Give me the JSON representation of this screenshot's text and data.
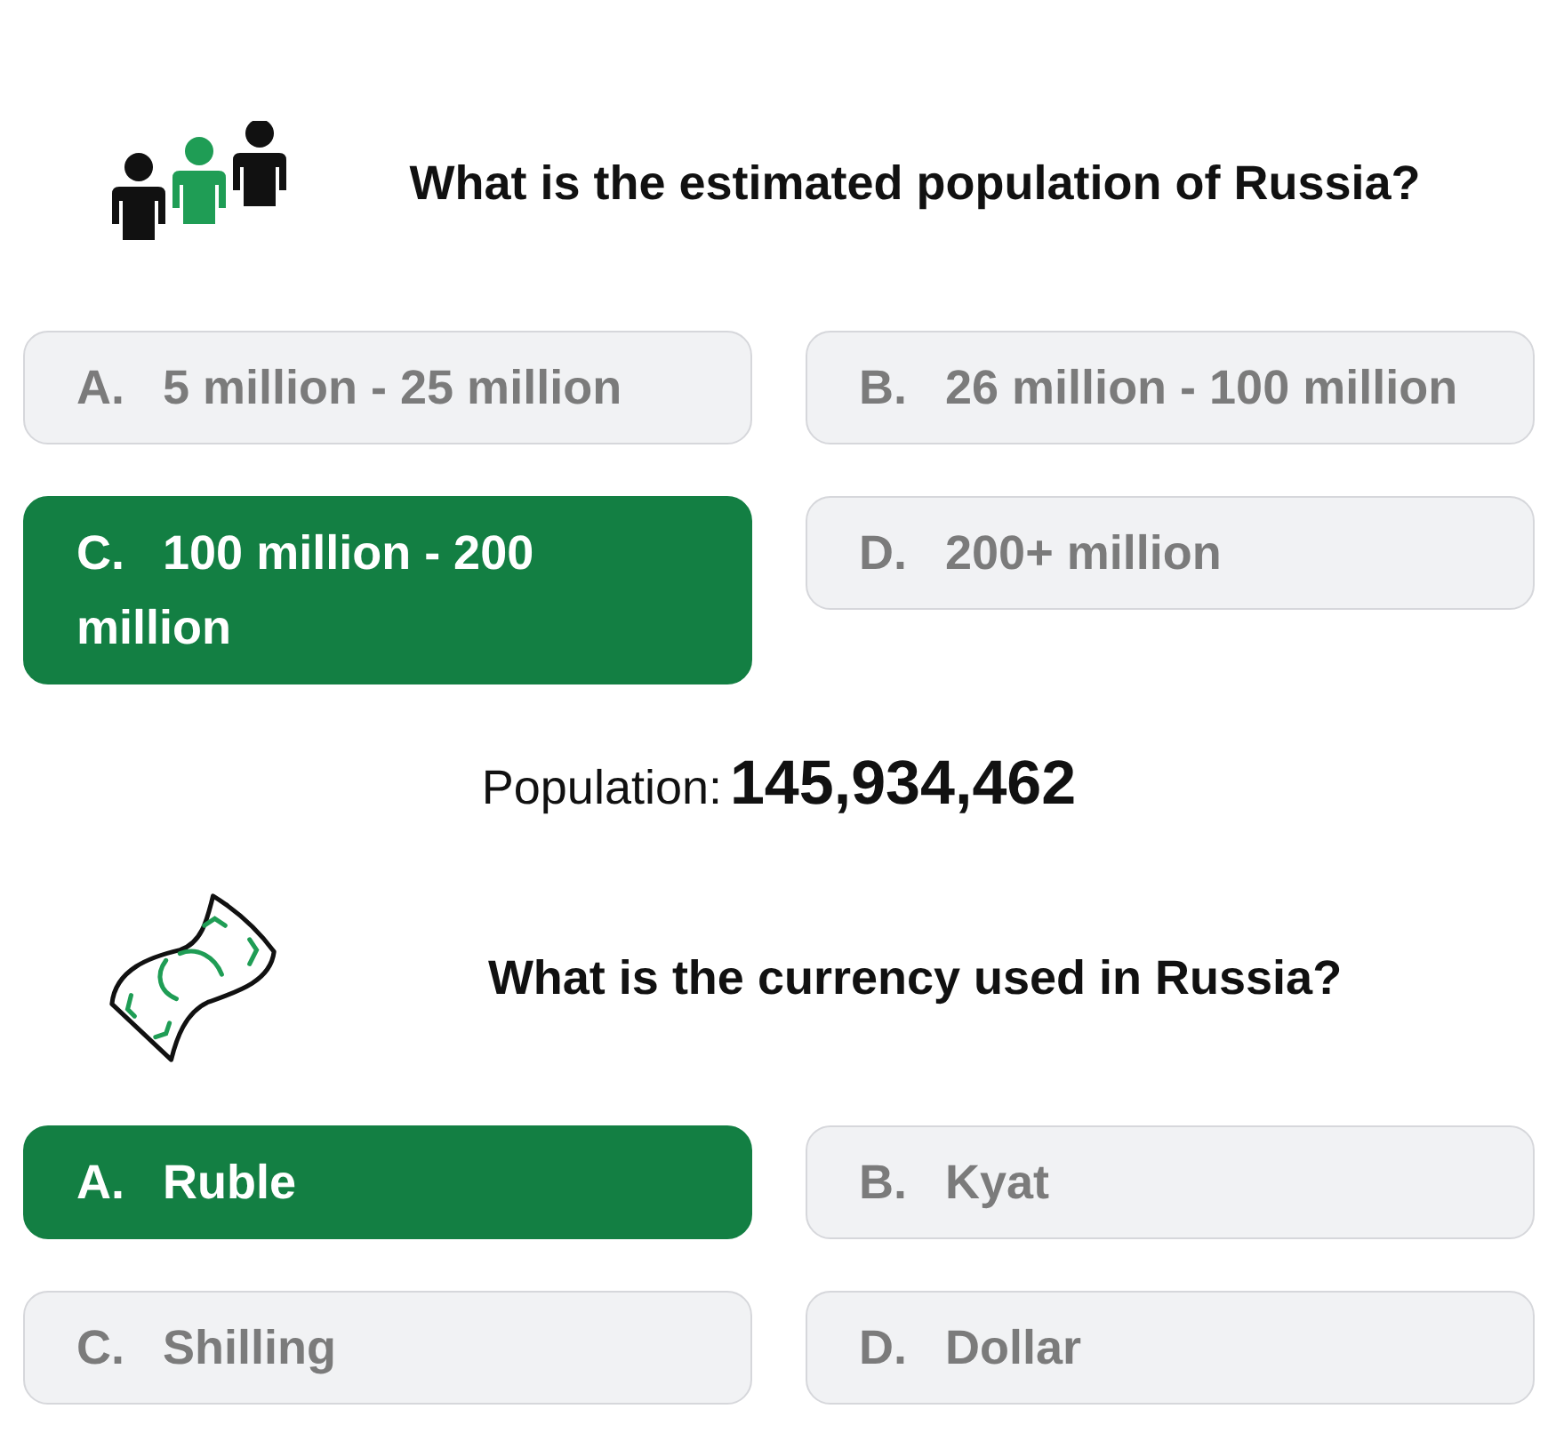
{
  "questions": [
    {
      "kind": "people",
      "title": "What is the estimated population of Russia?",
      "options": [
        {
          "letter": "A.",
          "text": "5 million - 25 million",
          "selected": false
        },
        {
          "letter": "B.",
          "text": "26 million - 100 million",
          "selected": false
        },
        {
          "letter": "C.",
          "text": "100 million - 200 million",
          "selected": true
        },
        {
          "letter": "D.",
          "text": "200+ million",
          "selected": false
        }
      ],
      "result": {
        "label": "Population:",
        "value": "145,934,462"
      }
    },
    {
      "kind": "money",
      "title": "What is the currency used in Russia?",
      "options": [
        {
          "letter": "A.",
          "text": "Ruble",
          "selected": true
        },
        {
          "letter": "B.",
          "text": "Kyat",
          "selected": false
        },
        {
          "letter": "C.",
          "text": "Shilling",
          "selected": false
        },
        {
          "letter": "D.",
          "text": "Dollar",
          "selected": false
        }
      ]
    }
  ]
}
